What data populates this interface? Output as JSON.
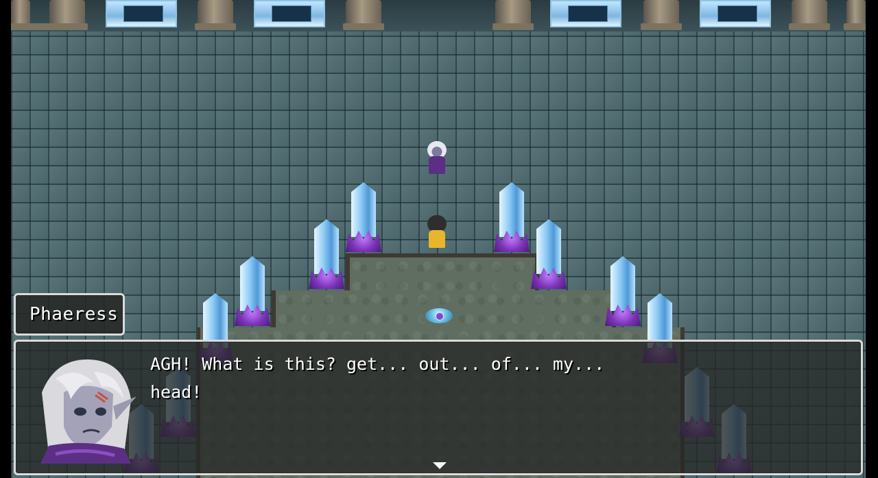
{
  "scene": {
    "location_icon": "crystal-chamber",
    "colors": {
      "floor": "#4f6b70",
      "crystal": "#8ccaf5",
      "crystal_base": "#7b34b8",
      "textbox_border": "#d9dcdc"
    }
  },
  "dialogue": {
    "speaker_name": "Phaeress",
    "message": "AGH! What is this? get... out... of... my...\nhead!",
    "continue_icon": "down-triangle-icon",
    "portrait_icon": "phaeress-portrait"
  }
}
